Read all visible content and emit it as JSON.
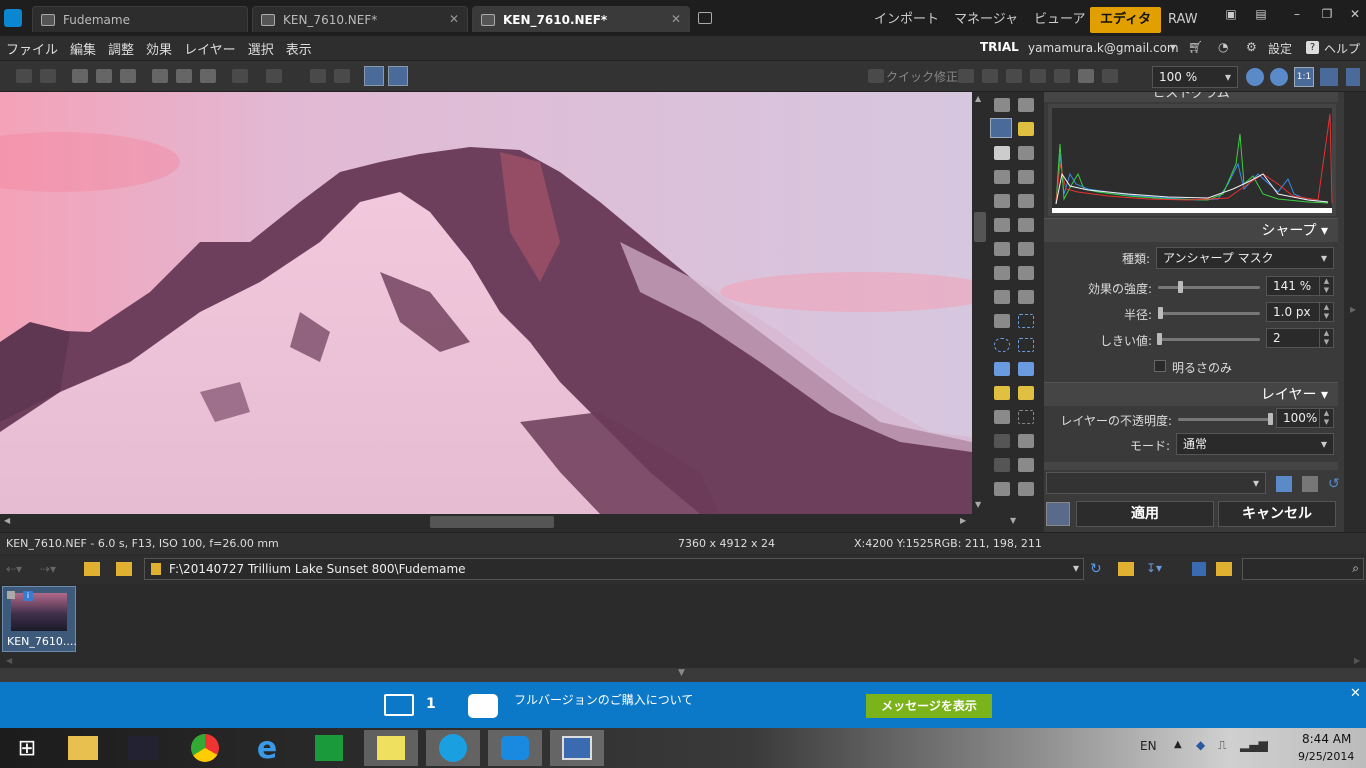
{
  "tabs": [
    {
      "label": "Fudemame",
      "active": false
    },
    {
      "label": "KEN_7610.NEF*",
      "active": false
    },
    {
      "label": "KEN_7610.NEF*",
      "active": true
    }
  ],
  "modes": {
    "import": "インポート",
    "manager": "マネージャ",
    "viewer": "ビューア",
    "editor": "エディタ",
    "raw": "RAW"
  },
  "menus": [
    "ファイル",
    "編集",
    "調整",
    "効果",
    "レイヤー",
    "選択",
    "表示"
  ],
  "account": {
    "trial": "TRIAL",
    "email": "yamamura.k@gmail.com",
    "settings": "設定",
    "help": "ヘルプ"
  },
  "toolbar": {
    "quickfix": "クイック修正",
    "zoom": "100 %"
  },
  "panel": {
    "histogram_title": "ヒストグラム",
    "sharpen_title": "シャープ",
    "type_label": "種類:",
    "type_value": "アンシャープ マスク",
    "strength_label": "効果の強度:",
    "strength_value": "141 %",
    "strength_level": 0.22,
    "radius_label": "半径:",
    "radius_value": "1.0 px",
    "radius_level": 0.02,
    "threshold_label": "しきい値:",
    "threshold_value": "2",
    "threshold_level": 0.01,
    "brightness_label": "明るさのみ",
    "layer_title": "レイヤー",
    "opacity_label": "レイヤーの不透明度:",
    "opacity_value": "100%",
    "opacity_level": 1.0,
    "mode_label": "モード:",
    "mode_value": "通常",
    "apply": "適用",
    "cancel": "キャンセル"
  },
  "status": {
    "file_info": "KEN_7610.NEF - 6.0 s, F13, ISO 100, f=26.00 mm",
    "dimensions": "7360 x 4912 x 24",
    "cursor": "X:4200 Y:1525",
    "rgb": "RGB: 211, 198, 211"
  },
  "path": "F:\\20140727 Trillium Lake Sunset 800\\Fudemame",
  "thumbnail": {
    "label": "KEN_7610...."
  },
  "notification": {
    "count": "1",
    "text": "フルバージョンのご購入について",
    "button": "メッセージを表示"
  },
  "taskbar": {
    "lang": "EN",
    "time": "8:44 AM",
    "date": "9/25/2014"
  },
  "colors": {
    "accent": "#e2a000",
    "notify_bg": "#0c78c8",
    "notify_button": "#7bb31a"
  }
}
